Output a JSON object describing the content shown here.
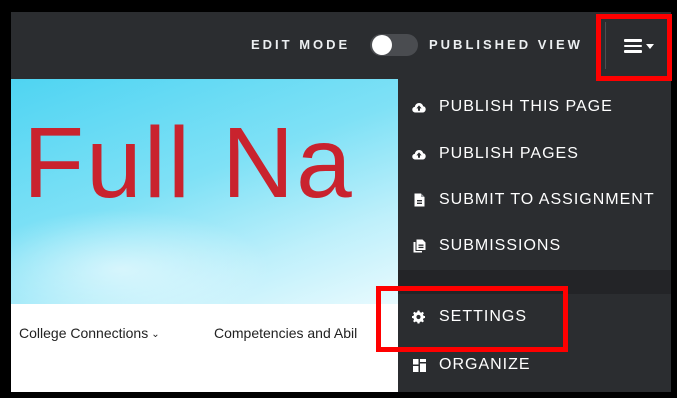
{
  "topbar": {
    "edit_mode_label": "EDIT MODE",
    "published_view_label": "PUBLISHED VIEW",
    "menu_icon": "hamburger-icon"
  },
  "hero": {
    "title": "Full Na"
  },
  "nav": {
    "items": [
      {
        "label": "College Connections",
        "has_dropdown": true
      },
      {
        "label": "Competencies and Abil",
        "has_dropdown": false
      }
    ]
  },
  "dropdown": {
    "items": [
      {
        "label": "PUBLISH THIS PAGE",
        "icon": "cloud-upload-icon"
      },
      {
        "label": "PUBLISH PAGES",
        "icon": "cloud-upload-icon"
      },
      {
        "label": "SUBMIT TO ASSIGNMENT",
        "icon": "document-icon"
      },
      {
        "label": "SUBMISSIONS",
        "icon": "documents-icon"
      },
      {
        "label": "SETTINGS",
        "icon": "gear-icon"
      },
      {
        "label": "ORGANIZE",
        "icon": "grid-icon"
      }
    ]
  },
  "colors": {
    "topbar_bg": "#2b2d30",
    "hero_title": "#c9232e",
    "highlight": "#ff0000"
  }
}
